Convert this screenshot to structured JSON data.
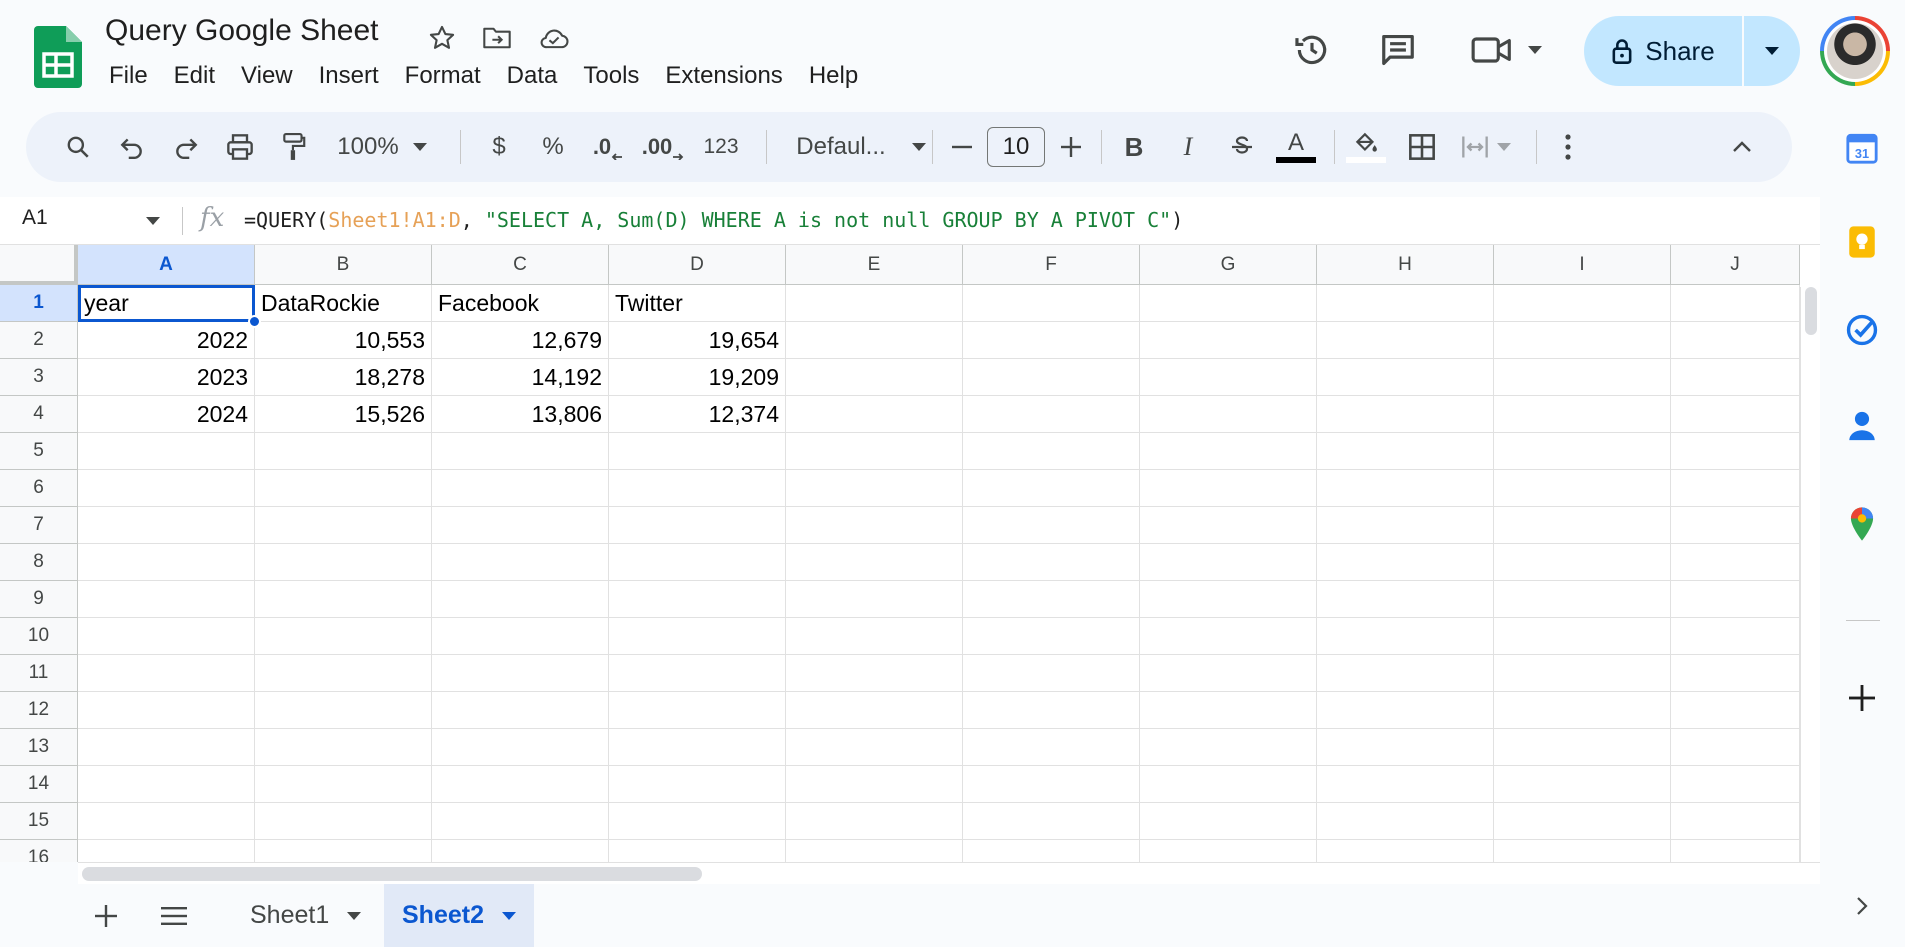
{
  "app": {
    "doc_title": "Query Google Sheet",
    "menu": [
      "File",
      "Edit",
      "View",
      "Insert",
      "Format",
      "Data",
      "Tools",
      "Extensions",
      "Help"
    ],
    "share_label": "Share"
  },
  "toolbar": {
    "zoom": "100%",
    "currency": "$",
    "percent": "%",
    "decrease_decimal": ".0",
    "increase_decimal": ".00",
    "number_format": "123",
    "font": "Defaul...",
    "font_size": "10"
  },
  "formula_bar": {
    "cell_ref": "A1",
    "fx": "fx",
    "prefix": "=QUERY(",
    "range": "Sheet1!A1:D",
    "separator": ", ",
    "query": "\"SELECT A, Sum(D) WHERE A is not null GROUP BY A PIVOT C\"",
    "suffix": ")"
  },
  "grid": {
    "columns": [
      "A",
      "B",
      "C",
      "D",
      "E",
      "F",
      "G",
      "H",
      "I",
      "J"
    ],
    "row_numbers": [
      "1",
      "2",
      "3",
      "4",
      "5",
      "6",
      "7",
      "8",
      "9",
      "10",
      "11",
      "12",
      "13",
      "14",
      "15",
      "16"
    ],
    "header_row": [
      "year",
      "DataRockie",
      "Facebook",
      "Twitter"
    ],
    "rows": [
      [
        "2022",
        "10,553",
        "12,679",
        "19,654"
      ],
      [
        "2023",
        "18,278",
        "14,192",
        "19,209"
      ],
      [
        "2024",
        "15,526",
        "13,806",
        "12,374"
      ]
    ],
    "selected_cell": "A1"
  },
  "sheets": {
    "tabs": [
      "Sheet1",
      "Sheet2"
    ],
    "active": "Sheet2"
  },
  "side_panel": {
    "icons": [
      "calendar-icon",
      "keep-icon",
      "tasks-icon",
      "contacts-icon",
      "maps-icon",
      "add-icon"
    ],
    "calendar_day": "31"
  },
  "colors": {
    "accent": "#0b57d0",
    "share_bg": "#c2e7ff",
    "sheets_green": "#0f9d58",
    "formula_range": "#e6a157",
    "formula_string": "#188038"
  }
}
